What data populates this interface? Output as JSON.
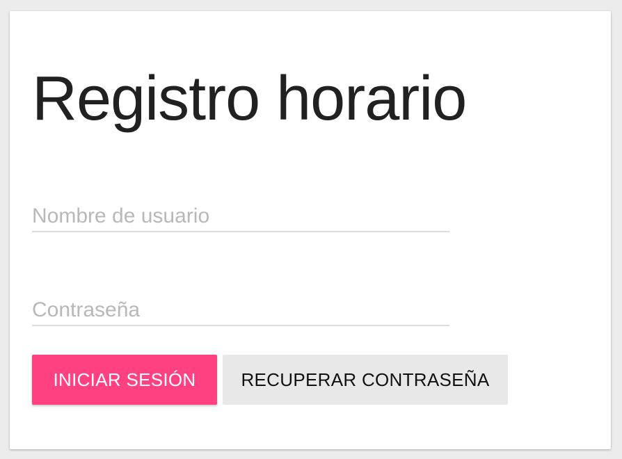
{
  "login": {
    "title": "Registro horario",
    "username_placeholder": "Nombre de usuario",
    "password_placeholder": "Contraseña",
    "login_button": "INICIAR SESIÓN",
    "recover_button": "RECUPERAR CONTRASEÑA"
  },
  "colors": {
    "accent": "#ff4081",
    "secondary_button": "#e8e8e8",
    "background": "#ebebeb"
  }
}
